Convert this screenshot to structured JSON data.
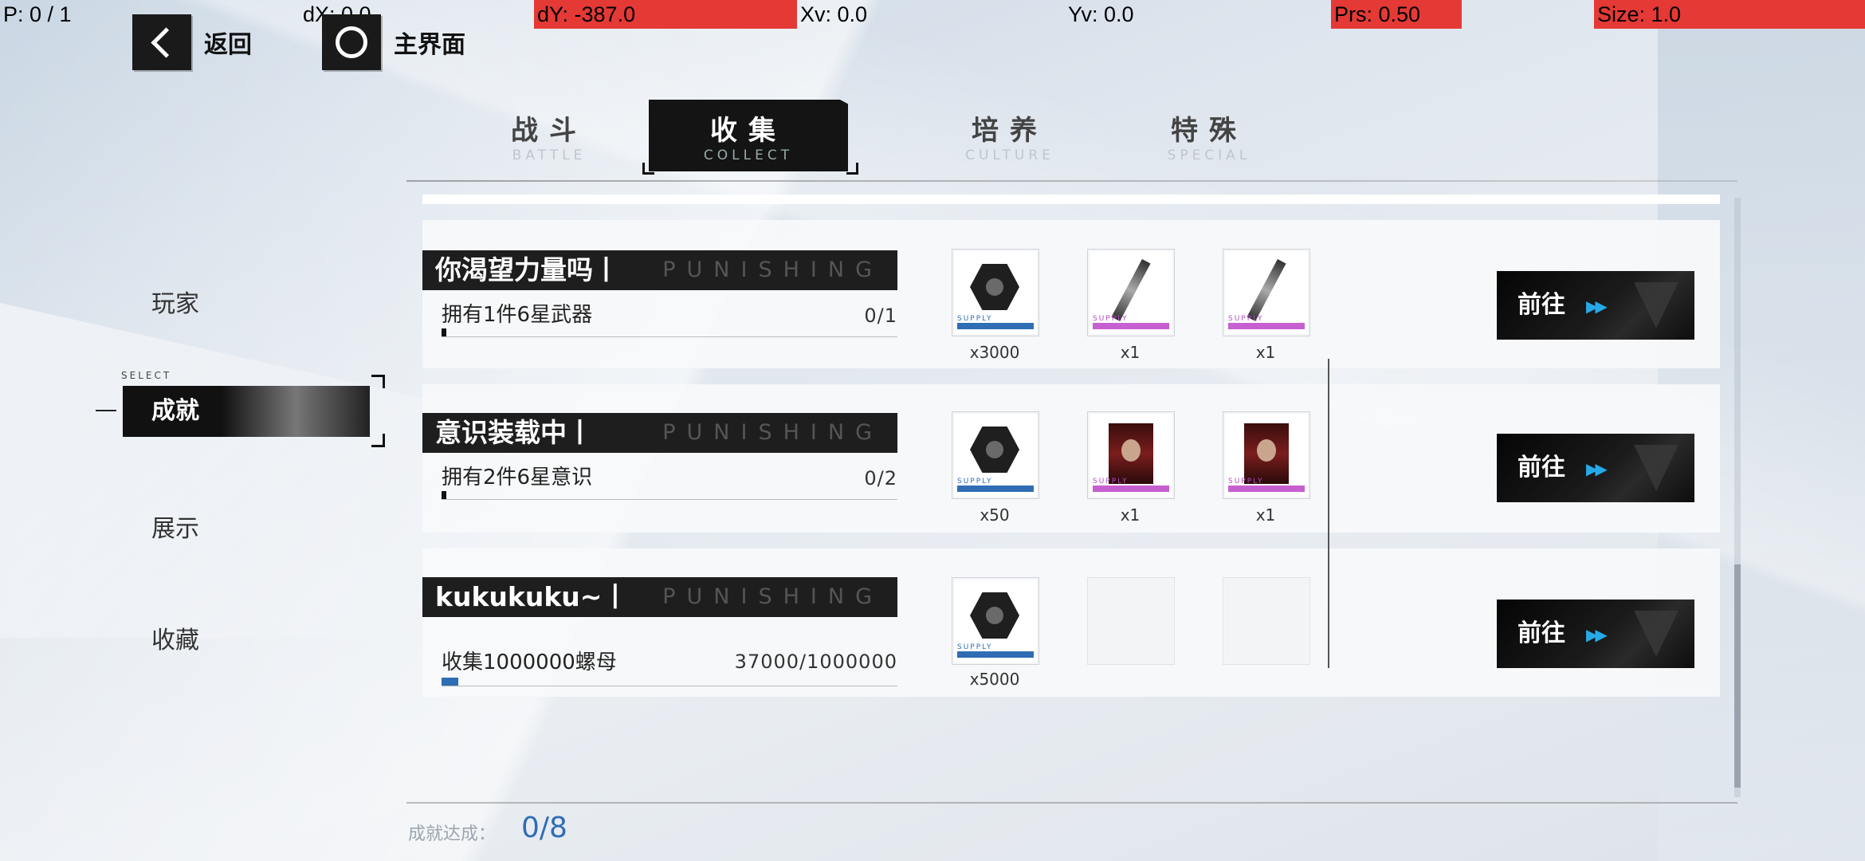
{
  "debug": {
    "p": "P: 0 / 1",
    "dx": "dX: 0.0",
    "dy": "dY: -387.0",
    "xv": "Xv: 0.0",
    "yv": "Yv: 0.0",
    "prs": "Prs: 0.50",
    "size": "Size: 1.0",
    "highlight_color": "#e53935"
  },
  "nav": {
    "back_label": "返回",
    "home_label": "主界面"
  },
  "tabs": [
    {
      "label": "战斗",
      "sub": "BATTLE",
      "active": false
    },
    {
      "label": "收集",
      "sub": "COLLECT",
      "active": true
    },
    {
      "label": "培养",
      "sub": "CULTURE",
      "active": false
    },
    {
      "label": "特殊",
      "sub": "SPECIAL",
      "active": false
    }
  ],
  "sidebar": {
    "select_tag": "SELECT",
    "items": [
      {
        "label": "玩家",
        "selected": false
      },
      {
        "label": "成就",
        "selected": true
      },
      {
        "label": "展示",
        "selected": false
      },
      {
        "label": "收藏",
        "selected": false
      }
    ]
  },
  "achievements": [
    {
      "title": "你渴望力量吗丨",
      "watermark": "PUNISHING",
      "desc": "拥有1件6星武器",
      "progress_text": "0/1",
      "progress": 0.0,
      "rewards": [
        {
          "icon": "hex-nut-icon",
          "qty": "x3000",
          "supply": "SUPPLY",
          "strip": "blue"
        },
        {
          "icon": "weapon-icon",
          "qty": "x1",
          "supply": "SUPPLY",
          "strip": "pink"
        },
        {
          "icon": "weapon-icon",
          "qty": "x1",
          "supply": "SUPPLY",
          "strip": "pink"
        }
      ],
      "button": "前往"
    },
    {
      "title": "意识装载中丨",
      "watermark": "PUNISHING",
      "desc": "拥有2件6星意识",
      "progress_text": "0/2",
      "progress": 0.0,
      "rewards": [
        {
          "icon": "hex-nut-icon",
          "qty": "x50",
          "supply": "SUPPLY",
          "strip": "blue"
        },
        {
          "icon": "memory-icon",
          "qty": "x1",
          "supply": "SUPPLY",
          "strip": "pink"
        },
        {
          "icon": "memory-icon",
          "qty": "x1",
          "supply": "SUPPLY",
          "strip": "pink"
        }
      ],
      "button": "前往"
    },
    {
      "title": "kukukuku~丨",
      "watermark": "PUNISHING",
      "desc": "收集1000000螺母",
      "progress_text": "37000/1000000",
      "progress": 0.037,
      "rewards": [
        {
          "icon": "hex-nut-icon",
          "qty": "x5000",
          "supply": "SUPPLY",
          "strip": "blue"
        }
      ],
      "button": "前往"
    }
  ],
  "footer": {
    "label": "成就达成：",
    "value": "0/8"
  },
  "colors": {
    "accent_blue": "#2f6db5",
    "arrow_cyan": "#27a9e8",
    "dark": "#141414",
    "pink_strip": "#c65fd0"
  }
}
